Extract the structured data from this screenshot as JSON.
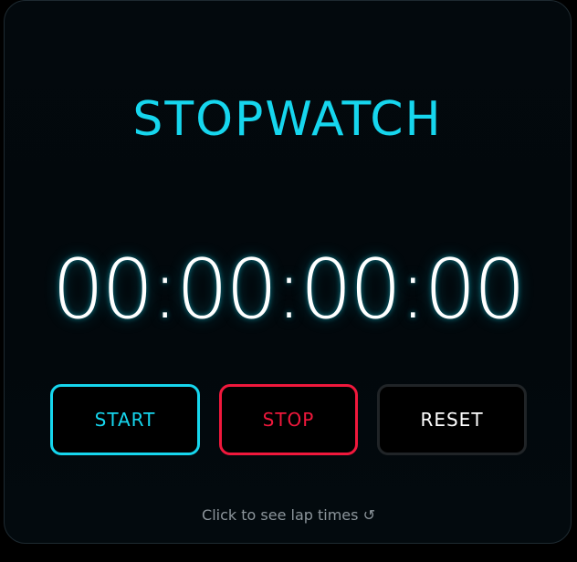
{
  "app": {
    "title": "STOPWATCH"
  },
  "display": {
    "time": "00:00:00:00"
  },
  "controls": {
    "start_label": "START",
    "stop_label": "STOP",
    "reset_label": "RESET"
  },
  "footer": {
    "lap_link": "Click to see lap times ↺"
  },
  "colors": {
    "accent_cyan": "#16d6ee",
    "stop_red": "#f0183c",
    "reset_border": "#202427",
    "background": "#03090d"
  }
}
